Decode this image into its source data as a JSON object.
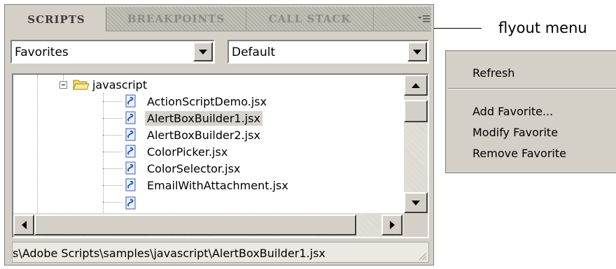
{
  "panel": {
    "tabs": [
      {
        "label": "SCRIPTS",
        "active": true
      },
      {
        "label": "BREAKPOINTS",
        "active": false
      },
      {
        "label": "CALL STACK",
        "active": false
      }
    ],
    "flyout_icon": "flyout-menu-icon",
    "dropdown_left": {
      "value": "Favorites"
    },
    "dropdown_right": {
      "value": "Default"
    },
    "tree": {
      "folder": {
        "label": "javascript",
        "expanded": true
      },
      "files": [
        {
          "label": "ActionScriptDemo.jsx",
          "selected": false
        },
        {
          "label": "AlertBoxBuilder1.jsx",
          "selected": true
        },
        {
          "label": "AlertBoxBuilder2.jsx",
          "selected": false
        },
        {
          "label": "ColorPicker.jsx",
          "selected": false
        },
        {
          "label": "ColorSelector.jsx",
          "selected": false
        },
        {
          "label": "EmailWithAttachment.jsx",
          "selected": false
        }
      ]
    },
    "status_path": "s\\Adobe Scripts\\samples\\javascript\\AlertBoxBuilder1.jsx"
  },
  "callout": {
    "label": "flyout menu"
  },
  "menu": {
    "items": [
      {
        "label": "Refresh"
      },
      {
        "label": "Add Favorite..."
      },
      {
        "label": "Modify Favorite"
      },
      {
        "label": "Remove Favorite"
      }
    ]
  },
  "colors": {
    "panel_bg": "#d4d0c8",
    "selection": "#d6d3ce",
    "tab_active_text": "#3a3a3a",
    "tab_inactive_text": "#8e8b85"
  }
}
